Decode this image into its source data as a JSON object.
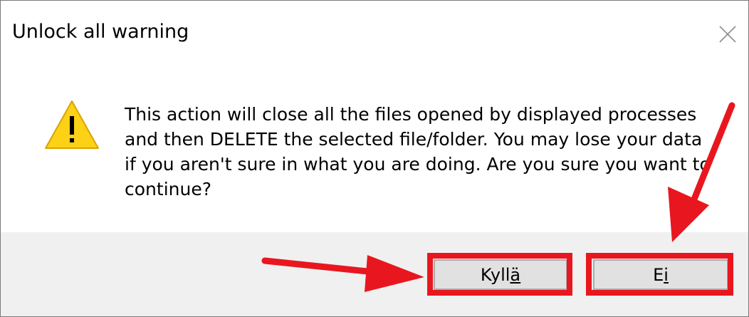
{
  "dialog": {
    "title": "Unlock all warning",
    "message": "This action will close all the files opened by displayed processes and then DELETE the selected file/folder. You may lose your data if you aren't sure in what you are doing. Are you sure you want to continue?",
    "icon": "warning-icon",
    "close_icon": "close-icon"
  },
  "buttons": {
    "yes_label_prefix": "Kyll",
    "yes_label_mnemonic": "ä",
    "no_label_prefix": "E",
    "no_label_mnemonic": "i"
  },
  "annotations": {
    "highlight_color": "#e8171f",
    "arrow_color": "#e8171f"
  },
  "colors": {
    "footer_bg": "#f0f0f0",
    "button_bg": "#e1e1e1",
    "warning_fill": "#fcd116",
    "warning_stroke": "#d9a400"
  }
}
